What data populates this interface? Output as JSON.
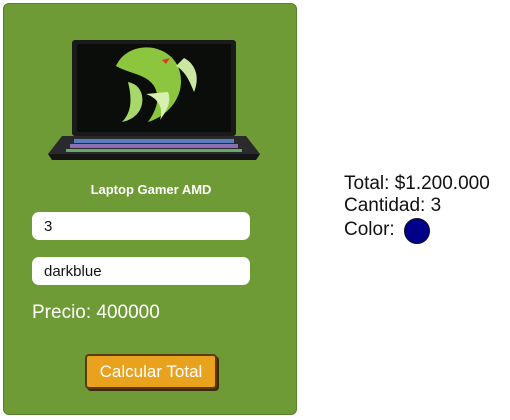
{
  "product": {
    "name": "Laptop Gamer AMD",
    "image_icon": "laptop-image",
    "quantity_value": "3",
    "color_value": "darkblue",
    "price_text": "Precio: 400000",
    "calculate_label": "Calcular Total"
  },
  "summary": {
    "total_text": "Total: $1.200.000",
    "quantity_text": "Cantidad: 3",
    "color_label": "Color:",
    "color_swatch": "#00008b"
  },
  "colors": {
    "card_bg": "#6f9b36",
    "button_bg": "#e8a21e"
  }
}
